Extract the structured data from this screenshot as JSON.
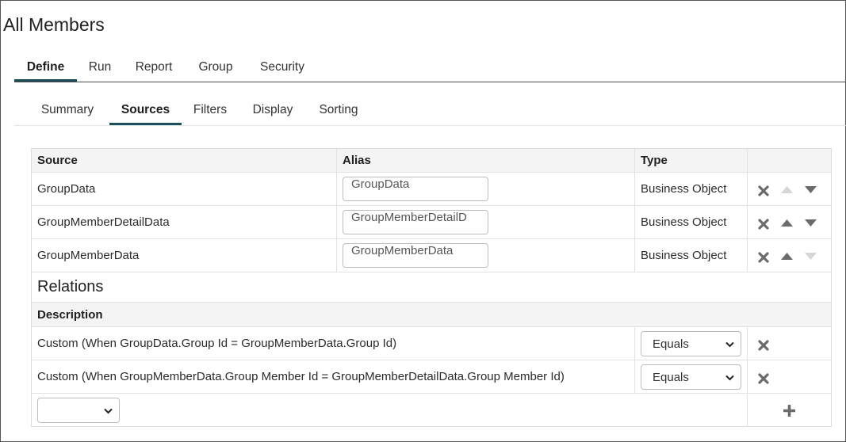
{
  "page": {
    "title": "All Members"
  },
  "main_tabs": [
    {
      "label": "Define",
      "active": true
    },
    {
      "label": "Run",
      "active": false
    },
    {
      "label": "Report",
      "active": false
    },
    {
      "label": "Group",
      "active": false
    },
    {
      "label": "Security",
      "active": false
    }
  ],
  "sub_tabs": [
    {
      "label": "Summary",
      "active": false
    },
    {
      "label": "Sources",
      "active": true
    },
    {
      "label": "Filters",
      "active": false
    },
    {
      "label": "Display",
      "active": false
    },
    {
      "label": "Sorting",
      "active": false
    }
  ],
  "sources": {
    "headers": {
      "source": "Source",
      "alias": "Alias",
      "type": "Type"
    },
    "rows": [
      {
        "source": "GroupData",
        "alias": "GroupData",
        "type": "Business Object",
        "up_enabled": false,
        "down_enabled": true
      },
      {
        "source": "GroupMemberDetailData",
        "alias": "GroupMemberDetailD",
        "type": "Business Object",
        "up_enabled": true,
        "down_enabled": true
      },
      {
        "source": "GroupMemberData",
        "alias": "GroupMemberData",
        "type": "Business Object",
        "up_enabled": true,
        "down_enabled": false
      }
    ]
  },
  "relations": {
    "title": "Relations",
    "header": "Description",
    "rows": [
      {
        "description": "Custom (When GroupData.Group Id = GroupMemberData.Group Id)",
        "operator": "Equals"
      },
      {
        "description": "Custom (When GroupMemberData.Group Member Id = GroupMemberDetailData.Group Member Id)",
        "operator": "Equals"
      }
    ],
    "new_select_value": ""
  },
  "colors": {
    "accent": "#1f4d5a",
    "icon_enabled": "#6b6b6b",
    "icon_disabled": "#d6d6d6",
    "header_bg": "#f4f4f4"
  },
  "icons": {
    "remove": "x-icon",
    "move_up": "arrow-up-icon",
    "move_down": "arrow-down-icon",
    "add": "plus-icon",
    "dropdown": "chevron-down-icon"
  }
}
